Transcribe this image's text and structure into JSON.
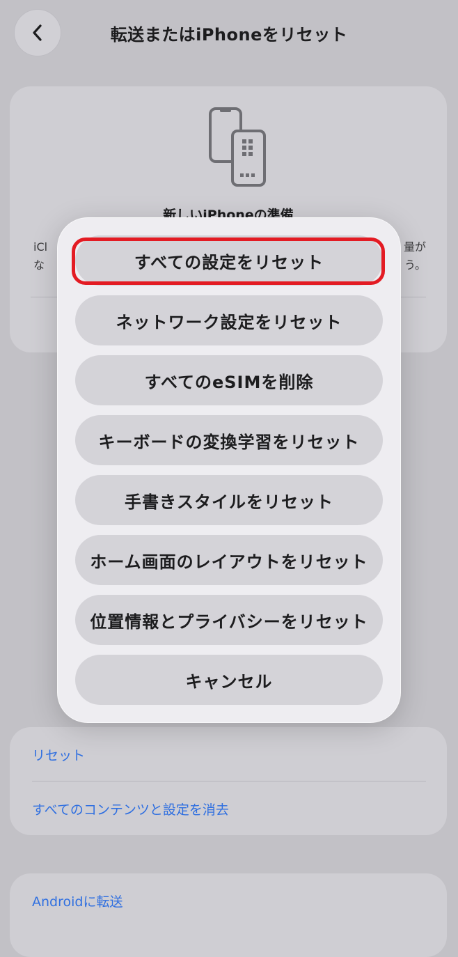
{
  "nav": {
    "title": "転送またはiPhoneをリセット",
    "back_icon": "chevron-left-icon"
  },
  "prepare_card": {
    "icon": "iphone-transfer-icon",
    "title": "新しいiPhoneの準備",
    "body_left": "iCl",
    "body_left2": "な",
    "body_right": "量が",
    "body_right2": "う。"
  },
  "action_sheet": {
    "items": [
      {
        "label": "すべての設定をリセット"
      },
      {
        "label": "ネットワーク設定をリセット"
      },
      {
        "label": "すべてのeSIMを削除"
      },
      {
        "label": "キーボードの変換学習をリセット"
      },
      {
        "label": "手書きスタイルをリセット"
      },
      {
        "label": "ホーム画面のレイアウトをリセット"
      },
      {
        "label": "位置情報とプライバシーをリセット"
      }
    ],
    "cancel": "キャンセル"
  },
  "reset_section": {
    "reset": "リセット",
    "erase": "すべてのコンテンツと設定を消去"
  },
  "android": {
    "label": "Androidに転送"
  },
  "colors": {
    "accent": "#2f6fe0",
    "highlight": "#e31b23"
  }
}
